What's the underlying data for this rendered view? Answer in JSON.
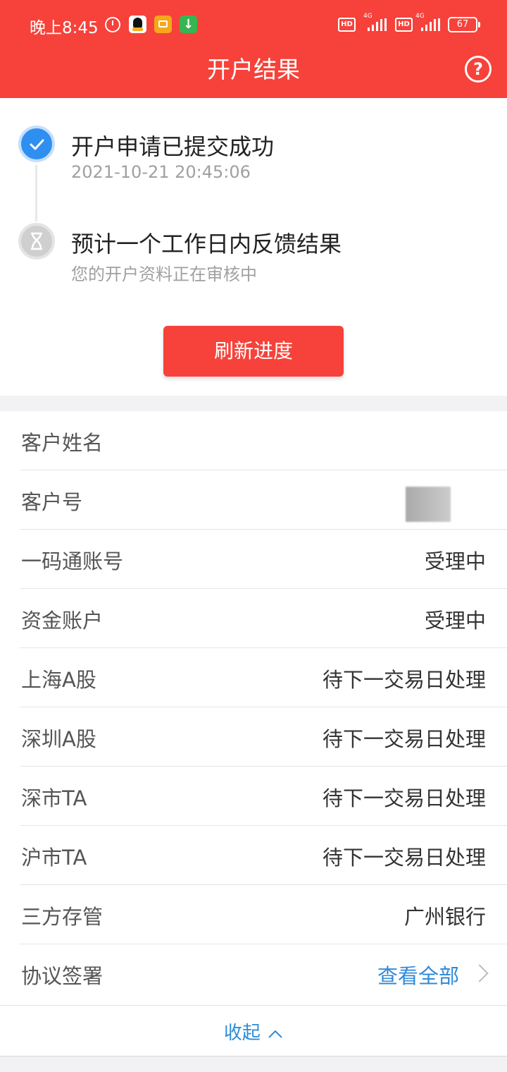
{
  "status_bar": {
    "time": "晚上8:45",
    "network1": "4G",
    "network2": "4G",
    "hd1": "HD",
    "hd2": "HD",
    "battery": "67",
    "download_glyph": "↓"
  },
  "header": {
    "title": "开户结果",
    "help_glyph": "?"
  },
  "progress": {
    "steps": [
      {
        "title": "开户申请已提交成功",
        "subtitle": "2021-10-21 20:45:06",
        "state": "done",
        "icon": "check-icon"
      },
      {
        "title": "预计一个工作日内反馈结果",
        "subtitle": "您的开户资料正在审核中",
        "state": "pending",
        "icon": "hourglass-icon"
      }
    ],
    "refresh_label": "刷新进度"
  },
  "details": {
    "rows": [
      {
        "label": "客户姓名",
        "value": ""
      },
      {
        "label": "客户号",
        "value": ""
      },
      {
        "label": "一码通账号",
        "value": "受理中"
      },
      {
        "label": "资金账户",
        "value": "受理中"
      },
      {
        "label": "上海A股",
        "value": "待下一交易日处理"
      },
      {
        "label": "深圳A股",
        "value": "待下一交易日处理"
      },
      {
        "label": "深市TA",
        "value": "待下一交易日处理"
      },
      {
        "label": "沪市TA",
        "value": "待下一交易日处理"
      },
      {
        "label": "三方存管",
        "value": "广州银行"
      },
      {
        "label": "协议签署",
        "value": "查看全部"
      }
    ],
    "collapse_label": "收起"
  },
  "colors": {
    "brand_red": "#f6423a",
    "link_blue": "#2f8bd8",
    "done_blue": "#2f8ff0"
  }
}
